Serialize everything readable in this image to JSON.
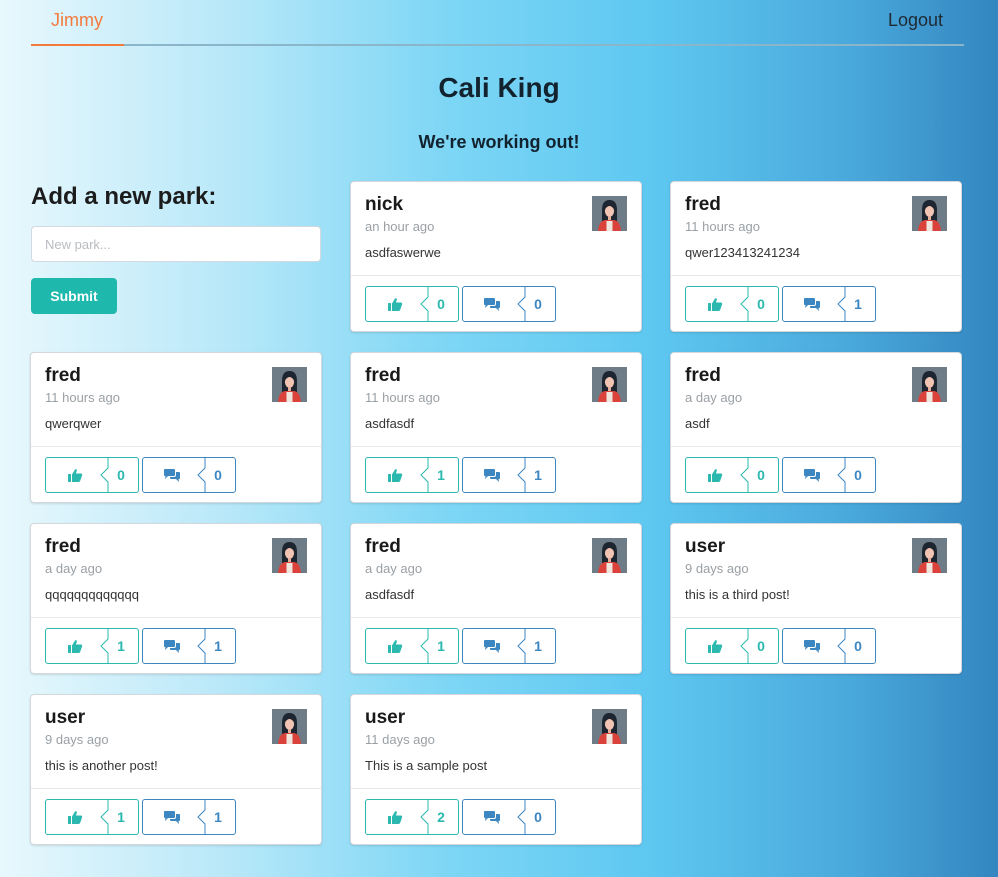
{
  "nav": {
    "user": "Jimmy",
    "logout": "Logout"
  },
  "header": {
    "title": "Cali King",
    "subtitle": "We're working out!"
  },
  "form": {
    "title": "Add a new park:",
    "placeholder": "New park...",
    "submit": "Submit"
  },
  "colors": {
    "accent": "#f47a3c",
    "teal": "#1fb8ad",
    "blue": "#3c86c1"
  },
  "posts": [
    {
      "author": "nick",
      "time": "an hour ago",
      "content": "asdfaswerwe",
      "likes": "0",
      "comments": "0"
    },
    {
      "author": "fred",
      "time": "11 hours ago",
      "content": "qwer123413241234",
      "likes": "0",
      "comments": "1"
    },
    {
      "author": "fred",
      "time": "11 hours ago",
      "content": "qwerqwer",
      "likes": "0",
      "comments": "0"
    },
    {
      "author": "fred",
      "time": "11 hours ago",
      "content": "asdfasdf",
      "likes": "1",
      "comments": "1"
    },
    {
      "author": "fred",
      "time": "a day ago",
      "content": "asdf",
      "likes": "0",
      "comments": "0"
    },
    {
      "author": "fred",
      "time": "a day ago",
      "content": "qqqqqqqqqqqqq",
      "likes": "1",
      "comments": "1"
    },
    {
      "author": "fred",
      "time": "a day ago",
      "content": "asdfasdf",
      "likes": "1",
      "comments": "1"
    },
    {
      "author": "user",
      "time": "9 days ago",
      "content": "this is a third post!",
      "likes": "0",
      "comments": "0"
    },
    {
      "author": "user",
      "time": "9 days ago",
      "content": "this is another post!",
      "likes": "1",
      "comments": "1"
    },
    {
      "author": "user",
      "time": "11 days ago",
      "content": "This is a sample post",
      "likes": "2",
      "comments": "0"
    }
  ]
}
